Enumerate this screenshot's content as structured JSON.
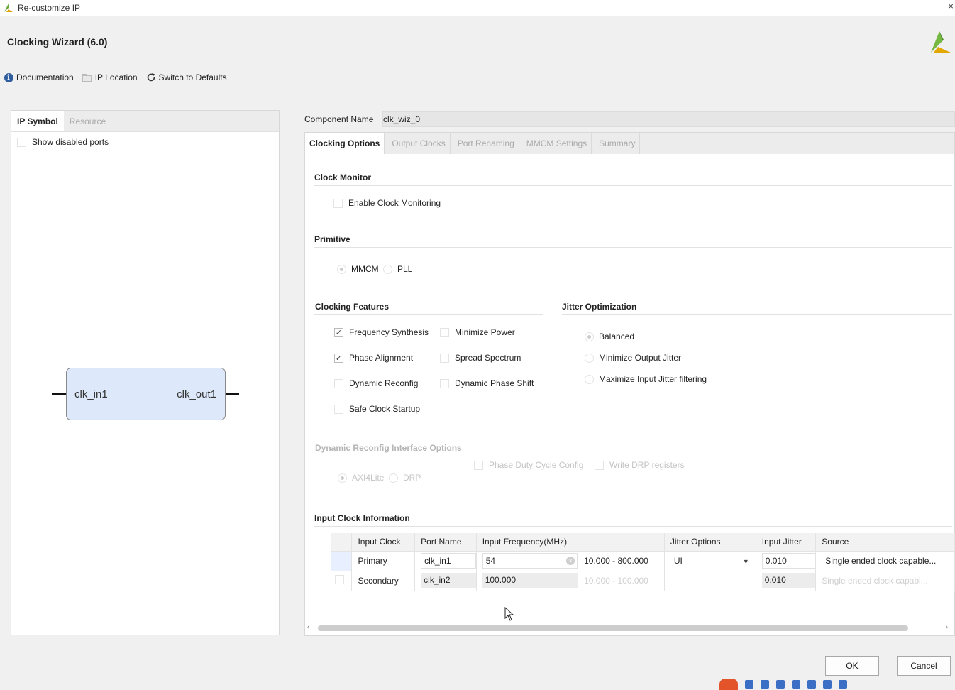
{
  "window": {
    "title": "Re-customize IP",
    "close_glyph": "×"
  },
  "header": {
    "title": "Clocking Wizard (6.0)",
    "toolbar": [
      {
        "label": "Documentation",
        "icon": "info-icon"
      },
      {
        "label": "IP Location",
        "icon": "folder-icon"
      },
      {
        "label": "Switch to Defaults",
        "icon": "refresh-icon"
      }
    ]
  },
  "left_panel": {
    "tabs": [
      "IP Symbol",
      "Resource"
    ],
    "show_disabled_ports": "Show disabled ports",
    "ip_symbol": {
      "input_port": "clk_in1",
      "output_port": "clk_out1"
    }
  },
  "component": {
    "label": "Component Name",
    "value": "clk_wiz_0"
  },
  "tabs": [
    "Clocking Options",
    "Output Clocks",
    "Port Renaming",
    "MMCM Settings",
    "Summary"
  ],
  "clock_monitor": {
    "title": "Clock Monitor",
    "enable_label": "Enable Clock Monitoring",
    "enabled": false
  },
  "primitive": {
    "title": "Primitive",
    "options": [
      "MMCM",
      "PLL"
    ],
    "selected": "MMCM"
  },
  "clocking_features": {
    "title": "Clocking Features",
    "items": [
      {
        "label": "Frequency Synthesis",
        "checked": true
      },
      {
        "label": "Minimize Power",
        "checked": false
      },
      {
        "label": "Phase Alignment",
        "checked": true
      },
      {
        "label": "Spread Spectrum",
        "checked": false
      },
      {
        "label": "Dynamic Reconfig",
        "checked": false
      },
      {
        "label": "Dynamic Phase Shift",
        "checked": false
      },
      {
        "label": "Safe Clock Startup",
        "checked": false
      }
    ]
  },
  "jitter_optimization": {
    "title": "Jitter Optimization",
    "options": [
      "Balanced",
      "Minimize Output Jitter",
      "Maximize Input Jitter filtering"
    ],
    "selected": "Balanced"
  },
  "dynamic_reconfig": {
    "title": "Dynamic Reconfig Interface Options",
    "interface_options": [
      "AXI4Lite",
      "DRP"
    ],
    "selected": "AXI4Lite",
    "checkboxes": [
      "Phase Duty Cycle Config",
      "Write DRP registers"
    ]
  },
  "input_clock": {
    "title": "Input Clock Information",
    "headers": [
      "Input Clock",
      "Port Name",
      "Input Frequency(MHz)",
      "",
      "Jitter Options",
      "Input Jitter",
      "Source"
    ],
    "rows": [
      {
        "clock": "Primary",
        "port": "clk_in1",
        "freq": "54",
        "range": "10.000 - 800.000",
        "jitter_option": "UI",
        "jitter": "0.010",
        "source": "Single ended clock capable..."
      },
      {
        "clock": "Secondary",
        "port": "clk_in2",
        "freq": "100.000",
        "range": "10.000 - 100.000",
        "jitter_option": "",
        "jitter": "0.010",
        "source": "Single ended clock capabl..."
      }
    ]
  },
  "buttons": {
    "ok": "OK",
    "cancel": "Cancel"
  }
}
